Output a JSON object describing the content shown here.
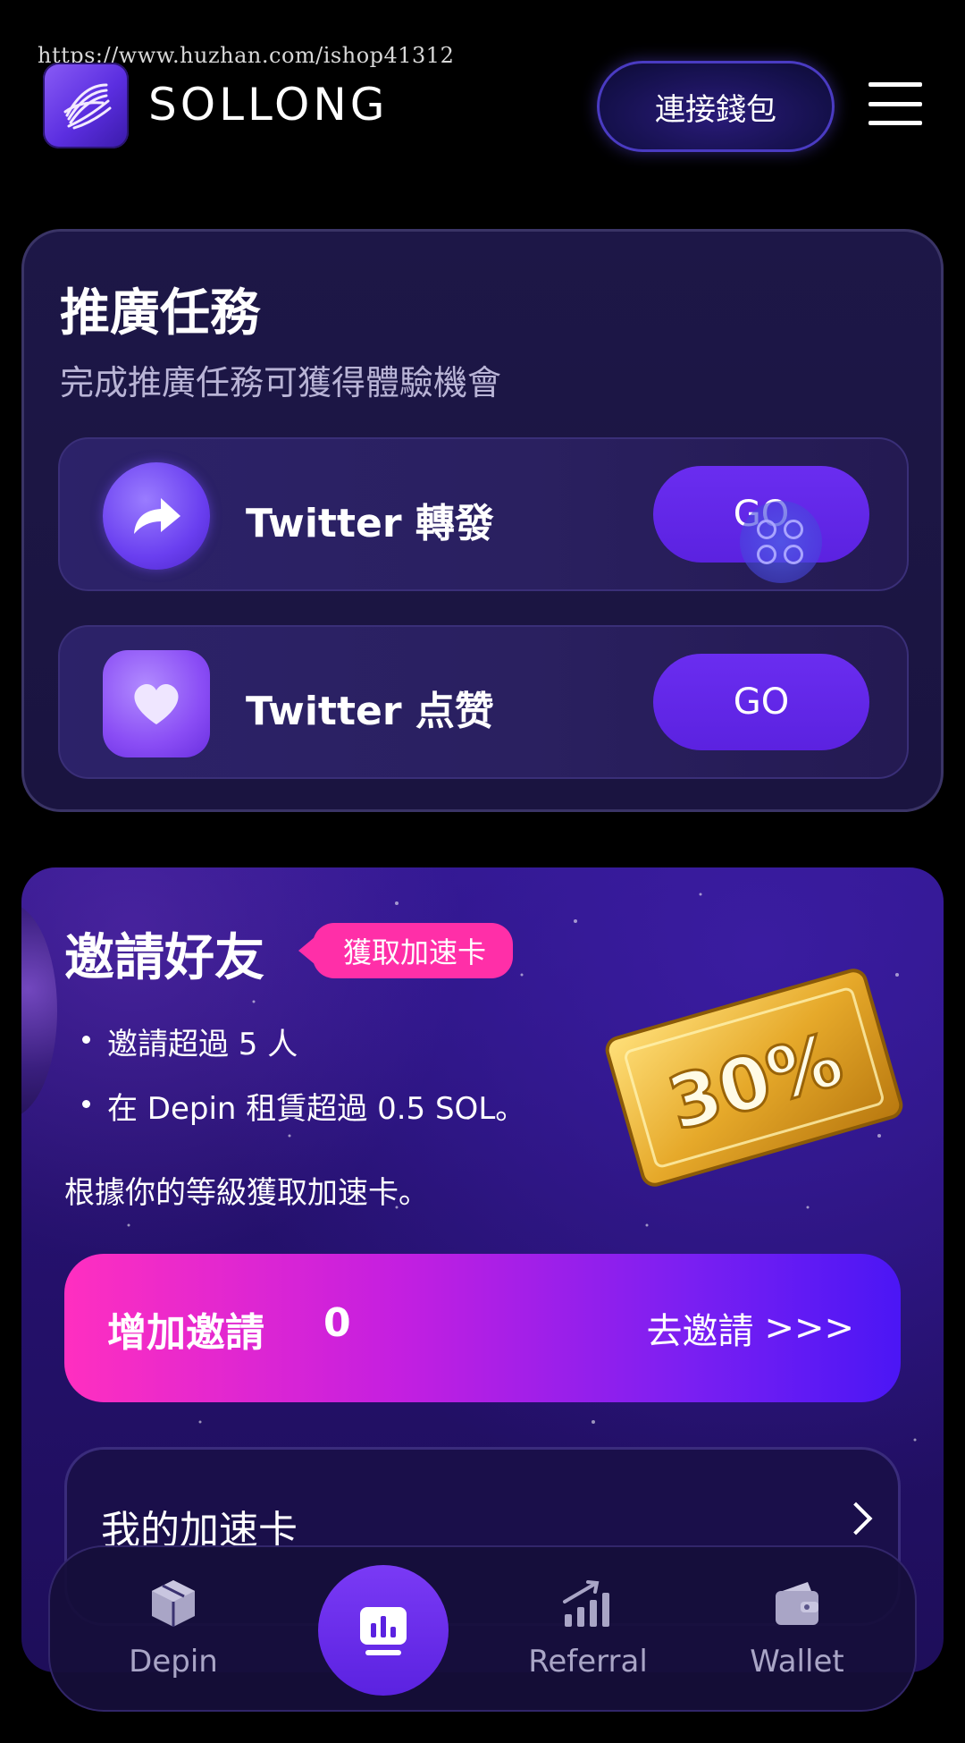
{
  "watermark": "https://www.huzhan.com/ishop41312",
  "header": {
    "logo_icon": "sollong-swirl-icon",
    "brand": "SOLLONG",
    "connect_wallet": "連接錢包",
    "menu_icon": "hamburger-menu-icon"
  },
  "promo": {
    "title": "推廣任務",
    "subtitle": "完成推廣任務可獲得體驗機會",
    "tasks": [
      {
        "label": "Twitter 轉發",
        "button": "GO",
        "icon": "share-arrow-icon"
      },
      {
        "label": "Twitter 点赞",
        "button": "GO",
        "icon": "heart-bubble-icon"
      }
    ]
  },
  "invite": {
    "title": "邀請好友",
    "tag": "獲取加速卡",
    "bullets": [
      "邀請超過 5 人",
      "在 Depin 租賃超過 0.5 SOL。"
    ],
    "note": "根據你的等級獲取加速卡。",
    "coupon_text": "30%",
    "bar": {
      "label": "增加邀請",
      "count": "0",
      "link": "去邀請",
      "link_arrows": ">>>"
    },
    "my_cards": "我的加速卡"
  },
  "bottom_nav": {
    "items": [
      {
        "label": "Depin",
        "icon": "cube-icon"
      },
      {
        "label": "",
        "icon": "chart-monitor-icon"
      },
      {
        "label": "Referral",
        "icon": "signal-bars-icon"
      },
      {
        "label": "Wallet",
        "icon": "wallet-icon"
      }
    ]
  },
  "colors": {
    "background": "#000000",
    "accent_purple": "#5b22e0",
    "tag_pink": "#ff2fa8",
    "card_bg": "#1d1747"
  }
}
